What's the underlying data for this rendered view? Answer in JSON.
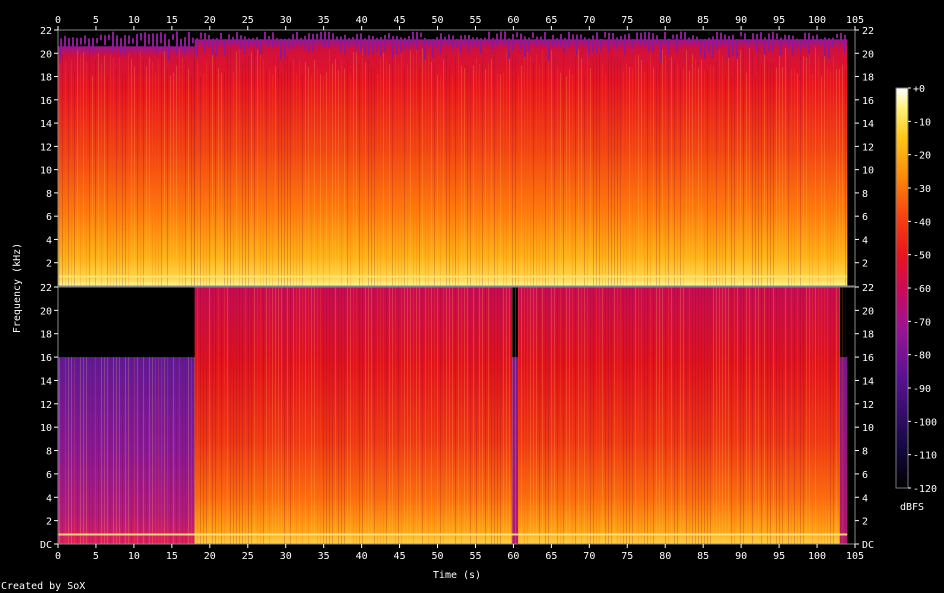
{
  "chart_data": {
    "type": "heatmap",
    "title": "",
    "xlabel": "Time (s)",
    "ylabel": "Frequency (kHz)",
    "x_ticks": [
      "0",
      "5",
      "10",
      "15",
      "20",
      "25",
      "30",
      "35",
      "40",
      "45",
      "50",
      "55",
      "60",
      "65",
      "70",
      "75",
      "80",
      "85",
      "90",
      "95",
      "100",
      "105"
    ],
    "xlim": [
      0,
      105
    ],
    "y_ticks": [
      "DC",
      "2",
      "4",
      "6",
      "8",
      "10",
      "12",
      "14",
      "16",
      "18",
      "20",
      "22"
    ],
    "ylim": [
      0,
      22
    ],
    "colorbar": {
      "label": "dBFS",
      "ticks": [
        "+0",
        "-10",
        "-20",
        "-30",
        "-40",
        "-50",
        "-60",
        "-70",
        "-80",
        "-90",
        "-100",
        "-110",
        "-120"
      ],
      "range": [
        -120,
        0
      ]
    },
    "channels": [
      {
        "name": "",
        "segments": [
          {
            "t0": 0,
            "t1": 18,
            "top_khz": 20.6,
            "level_db": -50
          },
          {
            "t0": 18,
            "t1": 104,
            "top_khz": 21.2,
            "level_db": -48
          }
        ]
      },
      {
        "name": "",
        "segments": [
          {
            "t0": 0,
            "t1": 18,
            "top_khz": 16.0,
            "level_db": -70
          },
          {
            "t0": 18,
            "t1": 59.8,
            "top_khz": 22,
            "level_db": -55
          },
          {
            "t0": 59.8,
            "t1": 60.6,
            "top_khz": 16.0,
            "level_db": -75
          },
          {
            "t0": 60.6,
            "t1": 103,
            "top_khz": 22,
            "level_db": -55
          },
          {
            "t0": 103,
            "t1": 104,
            "top_khz": 16.0,
            "level_db": -70
          }
        ]
      }
    ]
  },
  "footer": {
    "credit": "Created by SoX"
  }
}
